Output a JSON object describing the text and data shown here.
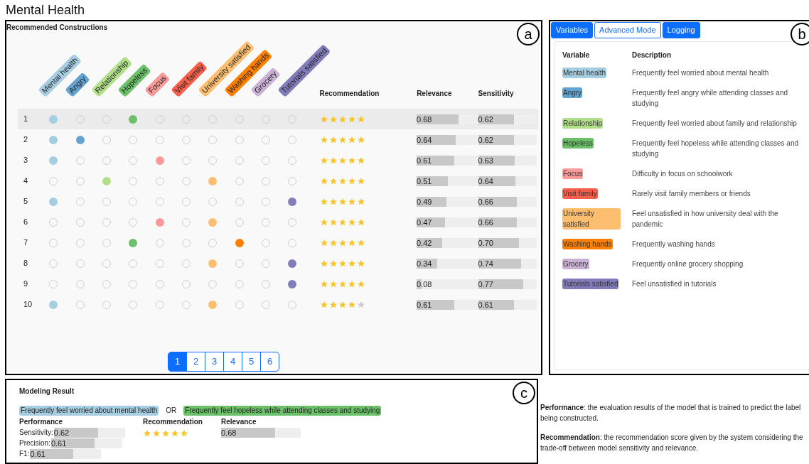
{
  "title": "Mental Health",
  "recommended": {
    "heading": "Recommended Constructions",
    "marker": "a",
    "variables": [
      {
        "label": "Mental health",
        "color": "#a6cee3"
      },
      {
        "label": "Angry",
        "color": "#62a3d0"
      },
      {
        "label": "Relationship",
        "color": "#b2df8a"
      },
      {
        "label": "Hopeless",
        "color": "#6cc06a"
      },
      {
        "label": "Focus",
        "color": "#fb9a99"
      },
      {
        "label": "Visit family",
        "color": "#f4604c"
      },
      {
        "label": "University satisfied",
        "color": "#fdbf6f"
      },
      {
        "label": "Washing hands",
        "color": "#ff7f00"
      },
      {
        "label": "Grocery",
        "color": "#cab2d6"
      },
      {
        "label": "Tutorials satisfied",
        "color": "#807dba"
      }
    ],
    "columns": [
      "Recommendation",
      "Relevance",
      "Sensitivity"
    ],
    "rows": [
      {
        "index": "1",
        "selected": true,
        "picked": [
          true,
          false,
          false,
          true,
          false,
          false,
          false,
          false,
          false,
          false
        ],
        "stars": 5,
        "relevance": {
          "text": "0.68",
          "level": 0.68
        },
        "sensitivity": {
          "text": "0.62",
          "level": 0.62
        }
      },
      {
        "index": "2",
        "selected": false,
        "picked": [
          true,
          true,
          false,
          false,
          false,
          false,
          false,
          false,
          false,
          false
        ],
        "stars": 5,
        "relevance": {
          "text": "0.64",
          "level": 0.64
        },
        "sensitivity": {
          "text": "0.62",
          "level": 0.62
        }
      },
      {
        "index": "3",
        "selected": false,
        "picked": [
          true,
          false,
          false,
          false,
          true,
          false,
          false,
          false,
          false,
          false
        ],
        "stars": 5,
        "relevance": {
          "text": "0.61",
          "level": 0.61
        },
        "sensitivity": {
          "text": "0.63",
          "level": 0.63
        }
      },
      {
        "index": "4",
        "selected": false,
        "picked": [
          false,
          false,
          true,
          false,
          false,
          false,
          true,
          false,
          false,
          false
        ],
        "stars": 5,
        "relevance": {
          "text": "0.51",
          "level": 0.51
        },
        "sensitivity": {
          "text": "0.64",
          "level": 0.64
        }
      },
      {
        "index": "5",
        "selected": false,
        "picked": [
          true,
          false,
          false,
          false,
          false,
          false,
          false,
          false,
          false,
          true
        ],
        "stars": 5,
        "relevance": {
          "text": "0.49",
          "level": 0.49
        },
        "sensitivity": {
          "text": "0.66",
          "level": 0.66
        }
      },
      {
        "index": "6",
        "selected": false,
        "picked": [
          false,
          false,
          false,
          false,
          true,
          false,
          true,
          false,
          false,
          false
        ],
        "stars": 5,
        "relevance": {
          "text": "0.47",
          "level": 0.47
        },
        "sensitivity": {
          "text": "0.66",
          "level": 0.66
        }
      },
      {
        "index": "7",
        "selected": false,
        "picked": [
          false,
          false,
          false,
          true,
          false,
          false,
          false,
          true,
          false,
          false
        ],
        "stars": 5,
        "relevance": {
          "text": "0.42",
          "level": 0.42
        },
        "sensitivity": {
          "text": "0.70",
          "level": 0.7
        }
      },
      {
        "index": "8",
        "selected": false,
        "picked": [
          false,
          false,
          false,
          false,
          false,
          false,
          true,
          false,
          false,
          true
        ],
        "stars": 5,
        "relevance": {
          "text": "0.34",
          "level": 0.34
        },
        "sensitivity": {
          "text": "0.74",
          "level": 0.74
        }
      },
      {
        "index": "9",
        "selected": false,
        "picked": [
          false,
          false,
          false,
          false,
          false,
          false,
          false,
          false,
          false,
          true
        ],
        "stars": 5,
        "relevance": {
          "text": "0.08",
          "level": 0.08
        },
        "sensitivity": {
          "text": "0.77",
          "level": 0.77
        }
      },
      {
        "index": "10",
        "selected": false,
        "picked": [
          true,
          false,
          false,
          false,
          false,
          false,
          true,
          false,
          false,
          false
        ],
        "stars": 4,
        "relevance": {
          "text": "0.61",
          "level": 0.61
        },
        "sensitivity": {
          "text": "0.61",
          "level": 0.61
        }
      }
    ],
    "pages": [
      {
        "label": "1",
        "selected": true
      },
      {
        "label": "2",
        "selected": false
      },
      {
        "label": "3",
        "selected": false
      },
      {
        "label": "4",
        "selected": false
      },
      {
        "label": "5",
        "selected": false
      },
      {
        "label": "6",
        "selected": false
      }
    ]
  },
  "variables_panel": {
    "marker": "b",
    "tabs": [
      {
        "label": "Variables",
        "kind": "solid"
      },
      {
        "label": "Advanced Mode",
        "kind": "outline"
      },
      {
        "label": "Logging",
        "kind": "solid"
      }
    ],
    "columns": [
      "Variable",
      "Description"
    ],
    "rows": [
      {
        "label": "Mental health",
        "color": "#a6cee3",
        "description": "Frequently feel worried about mental health"
      },
      {
        "label": "Angry",
        "color": "#62a3d0",
        "description": "Frequently feel angry while attending classes and studying"
      },
      {
        "label": "Relationship",
        "color": "#b2df8a",
        "description": "Frequently feel worried about family and relationship"
      },
      {
        "label": "Hopeless",
        "color": "#6cc06a",
        "description": "Frequently feel hopeless while attending classes and studying"
      },
      {
        "label": "Focus",
        "color": "#fb9a99",
        "description": "Difficulty in focus on schoolwork"
      },
      {
        "label": "Visit family",
        "color": "#f4604c",
        "description": "Rarely visit family members or friends"
      },
      {
        "label": "University satisfied",
        "color": "#fdbf6f",
        "description": "Feel unsatisfied in how university deal with the pandemic"
      },
      {
        "label": "Washing hands",
        "color": "#ff7f00",
        "description": "Frequently washing hands"
      },
      {
        "label": "Grocery",
        "color": "#cab2d6",
        "description": "Frequently online grocery shopping"
      },
      {
        "label": "Tutorials satisfied",
        "color": "#807dba",
        "description": "Feel unsatisfied in tutorials"
      }
    ]
  },
  "modeling_result": {
    "heading": "Modeling Result",
    "marker": "c",
    "terms": [
      {
        "text": "Frequently feel worried about mental health",
        "color": "#a6cee3"
      },
      {
        "text": "Frequently feel hopeless while attending classes and studying",
        "color": "#6cc06a"
      }
    ],
    "operator": "OR",
    "performance": {
      "heading": "Performance",
      "metrics": [
        {
          "label": "Sensitivity:",
          "text": "0.62",
          "level": 0.62
        },
        {
          "label": "Precision:",
          "text": "0.61",
          "level": 0.61
        },
        {
          "label": "F1:",
          "text": "0.61",
          "level": 0.61
        }
      ]
    },
    "recommendation": {
      "heading": "Recommendation",
      "stars": 5
    },
    "relevance": {
      "heading": "Relevance",
      "text": "0.68",
      "level": 0.68
    }
  },
  "notes": [
    "**Performance**: the evaluation results of the model that is trained to predict the label being constructed.",
    "**Recommendation**: the recommendation score given by the system considering the trade-off between model sensitivity and relevance."
  ]
}
